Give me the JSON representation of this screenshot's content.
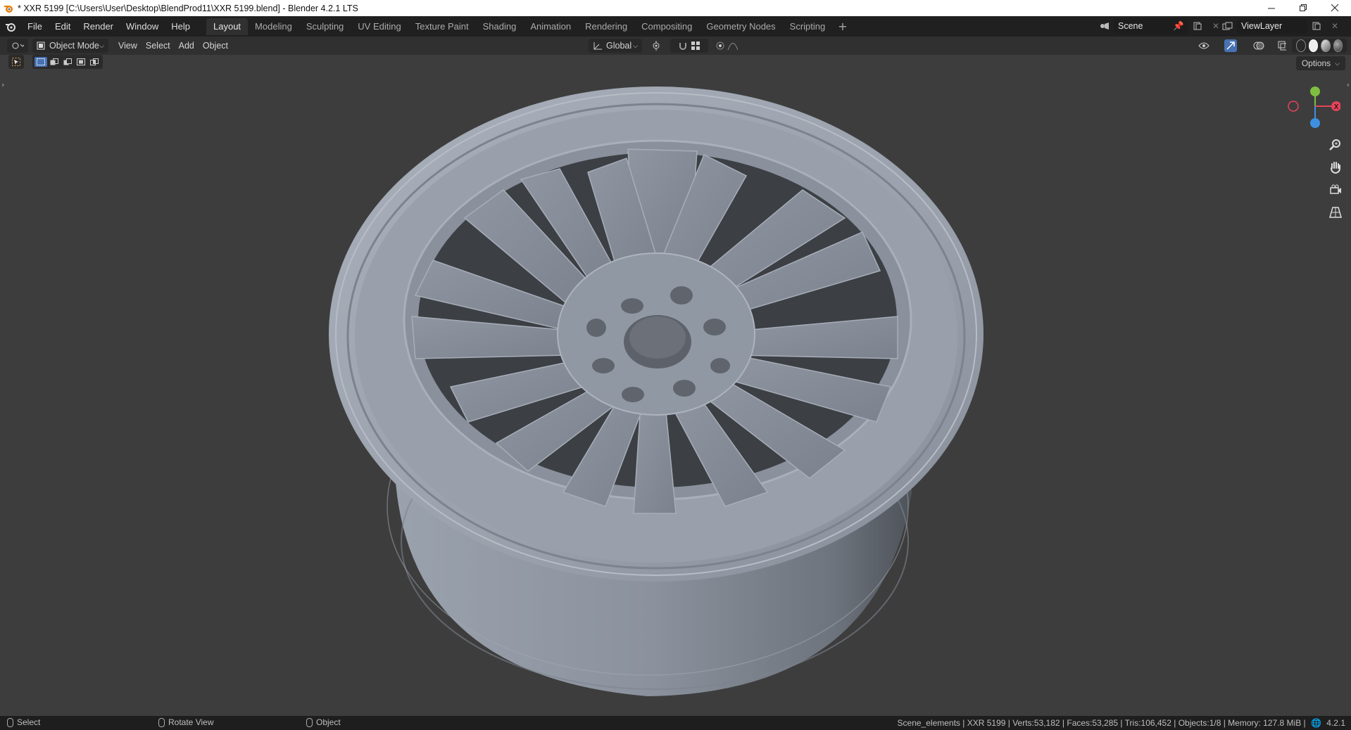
{
  "window": {
    "title": "* XXR 5199 [C:\\Users\\User\\Desktop\\BlendProd11\\XXR 5199.blend] - Blender 4.2.1 LTS"
  },
  "menu": {
    "items": [
      "File",
      "Edit",
      "Render",
      "Window",
      "Help"
    ]
  },
  "workspaces": {
    "tabs": [
      "Layout",
      "Modeling",
      "Sculpting",
      "UV Editing",
      "Texture Paint",
      "Shading",
      "Animation",
      "Rendering",
      "Compositing",
      "Geometry Nodes",
      "Scripting"
    ],
    "active": "Layout"
  },
  "scene": {
    "name": "Scene"
  },
  "view_layer": {
    "name": "ViewLayer"
  },
  "viewport_header": {
    "mode": "Object Mode",
    "menus": [
      "View",
      "Select",
      "Add",
      "Object"
    ],
    "orientation": "Global"
  },
  "viewport": {
    "options_label": "Options",
    "gizmo_axes": {
      "x": "X",
      "y": "Y",
      "z": "Z"
    },
    "colors": {
      "x_axis": "#e3445a",
      "y_axis": "#7fbf3f",
      "z_axis": "#3f8fe0",
      "background": "#3d3d3d"
    }
  },
  "statusbar": {
    "select": "Select",
    "rotate": "Rotate View",
    "object": "Object",
    "stats": "Scene_elements | XXR 5199 | Verts:53,182 | Faces:53,285 | Tris:106,452 | Objects:1/8 | Memory: 127.8 MiB |",
    "version": "4.2.1"
  }
}
